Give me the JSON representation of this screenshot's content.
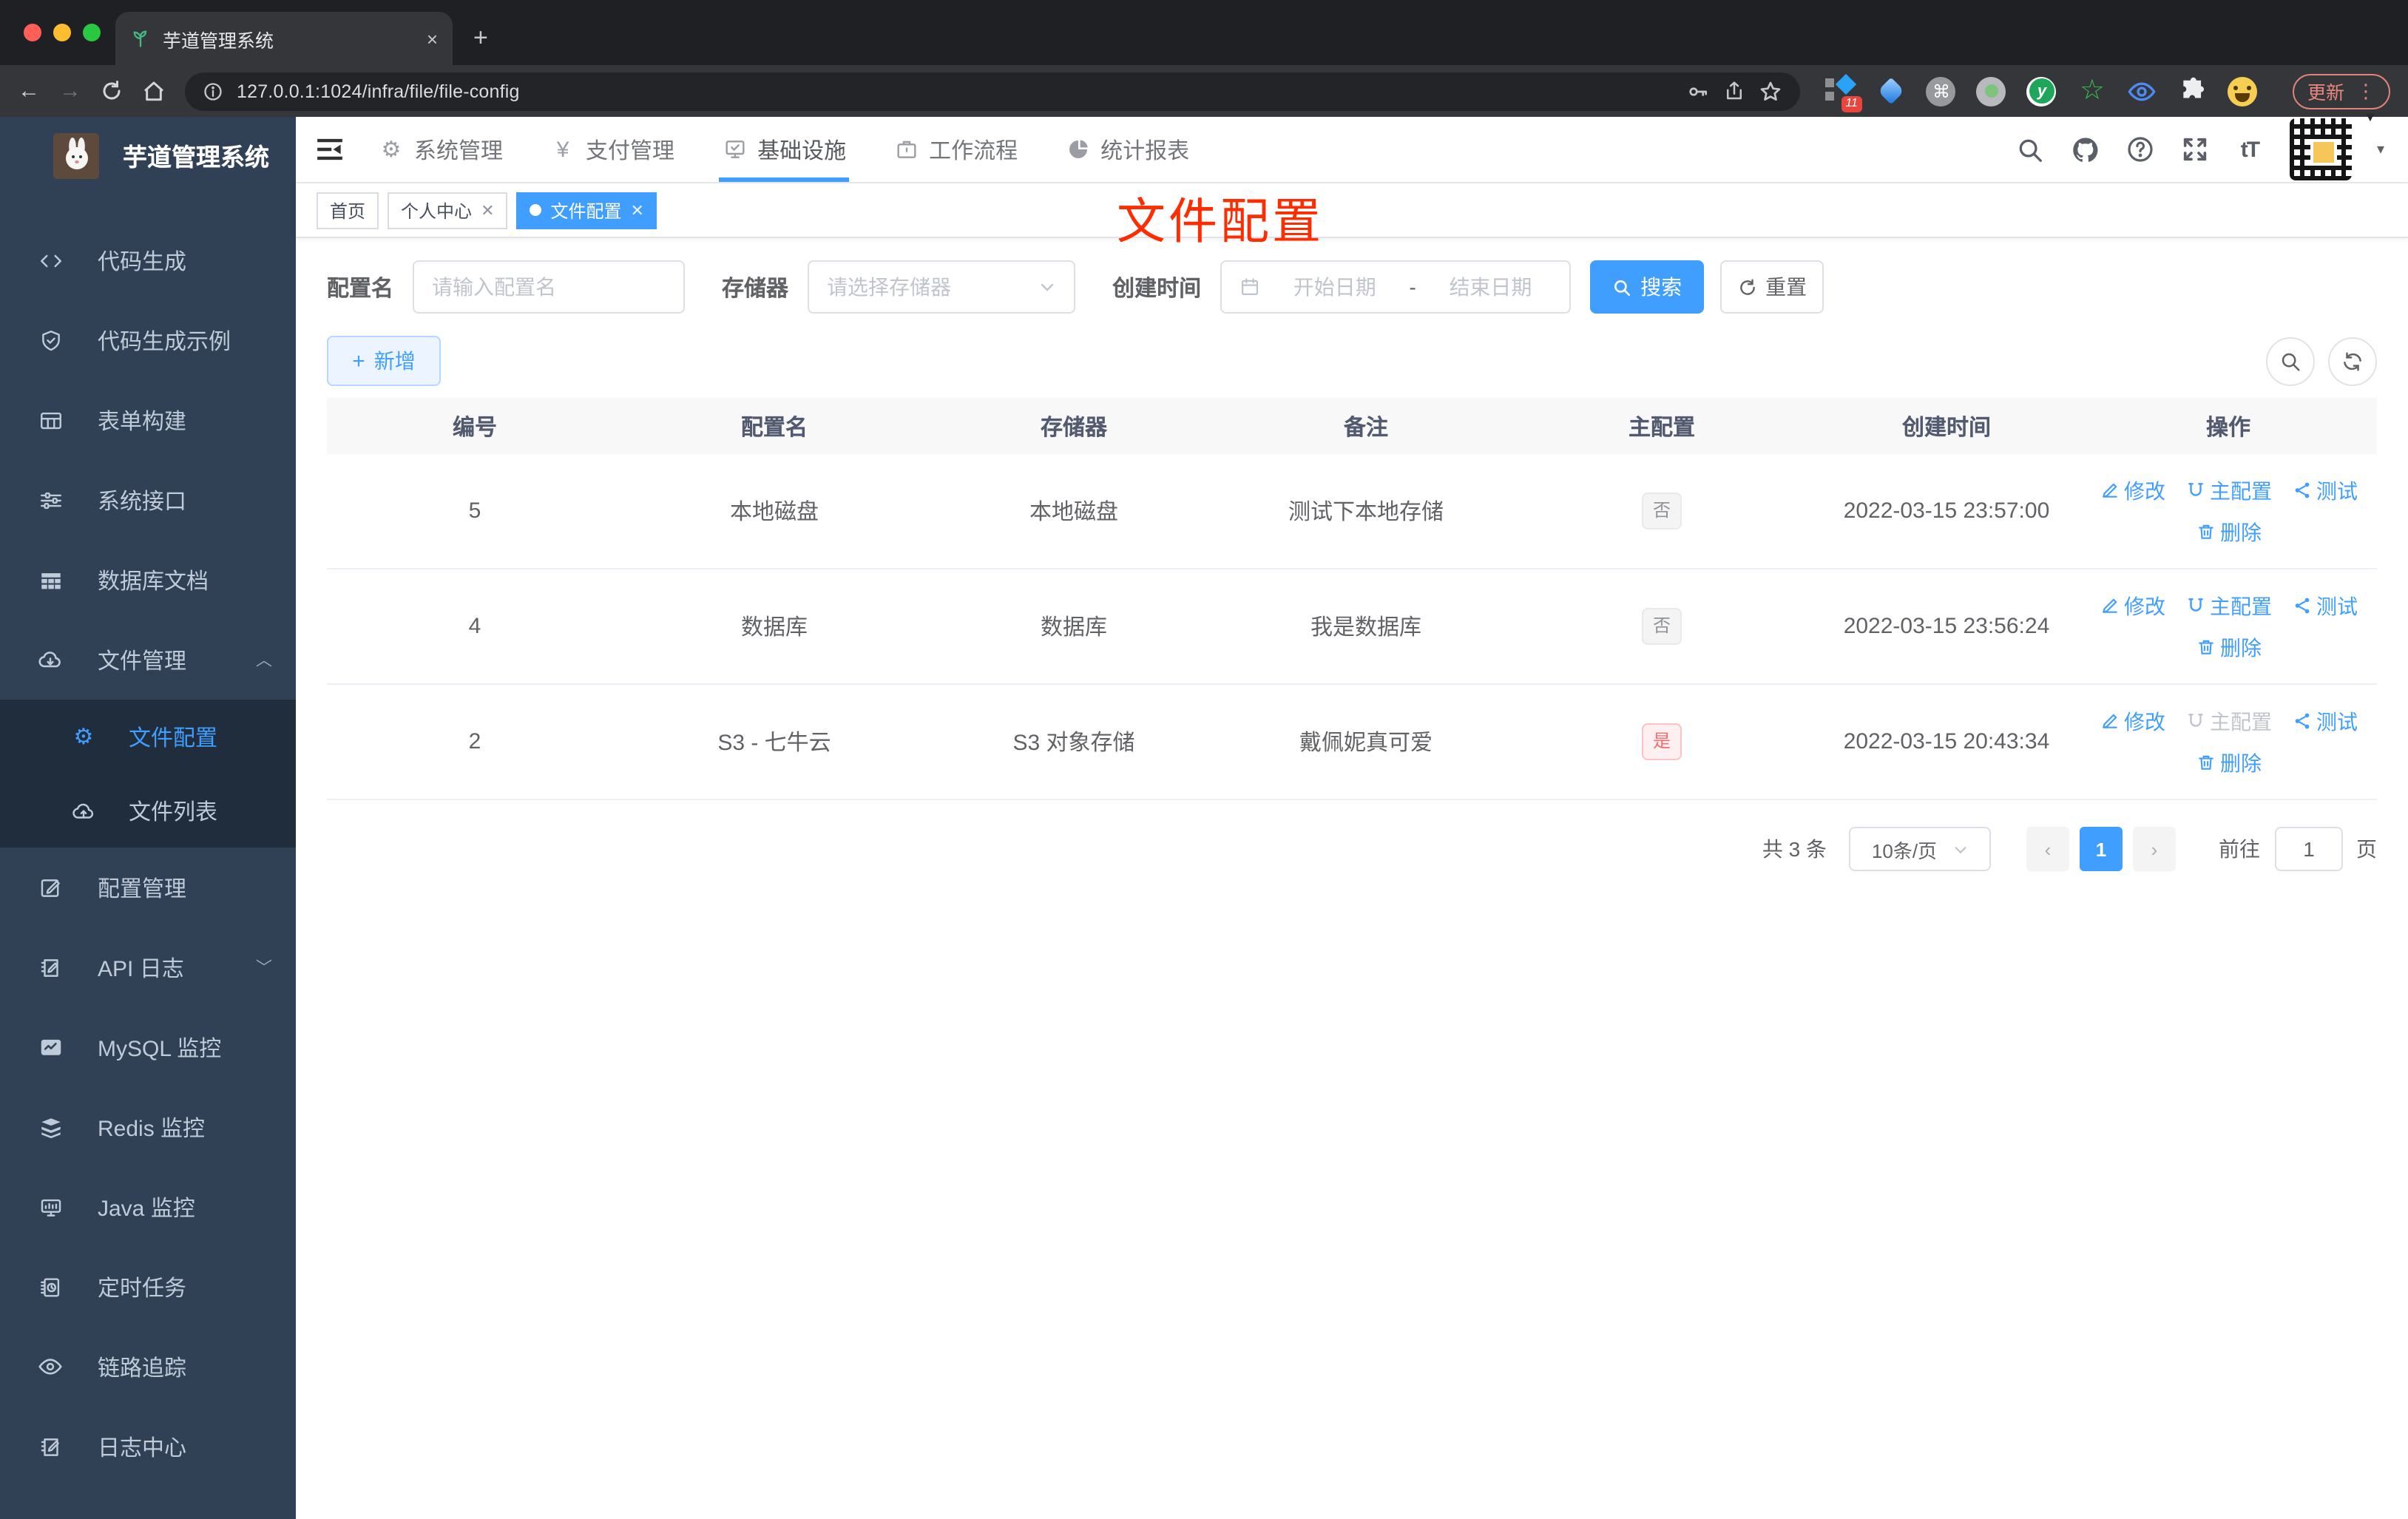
{
  "browser": {
    "tab_title": "芋道管理系统",
    "url": "127.0.0.1:1024/infra/file/file-config",
    "update_label": "更新",
    "extension_badge": "11",
    "new_tab_label": "+",
    "close_tab_label": "×"
  },
  "sidebar": {
    "logo_title": "芋道管理系统",
    "items": [
      {
        "label": "代码生成"
      },
      {
        "label": "代码生成示例"
      },
      {
        "label": "表单构建"
      },
      {
        "label": "系统接口"
      },
      {
        "label": "数据库文档"
      },
      {
        "label": "文件管理"
      },
      {
        "label": "配置管理"
      },
      {
        "label": "API 日志"
      },
      {
        "label": "MySQL 监控"
      },
      {
        "label": "Redis 监控"
      },
      {
        "label": "Java 监控"
      },
      {
        "label": "定时任务"
      },
      {
        "label": "链路追踪"
      },
      {
        "label": "日志中心"
      }
    ],
    "submenu": [
      {
        "label": "文件配置"
      },
      {
        "label": "文件列表"
      }
    ]
  },
  "header": {
    "nav": [
      {
        "label": "系统管理"
      },
      {
        "label": "支付管理"
      },
      {
        "label": "基础设施"
      },
      {
        "label": "工作流程"
      },
      {
        "label": "统计报表"
      }
    ],
    "font_size_icon": "tT"
  },
  "tags": [
    {
      "label": "首页"
    },
    {
      "label": "个人中心"
    },
    {
      "label": "文件配置"
    }
  ],
  "annotation": {
    "text": "文件配置",
    "color": "#fe2c00"
  },
  "filters": {
    "name_label": "配置名",
    "name_placeholder": "请输入配置名",
    "storage_label": "存储器",
    "storage_placeholder": "请选择存储器",
    "date_label": "创建时间",
    "date_start_placeholder": "开始日期",
    "date_separator": "-",
    "date_end_placeholder": "结束日期",
    "search_label": "搜索",
    "reset_label": "重置"
  },
  "toolbar": {
    "add_label": "新增"
  },
  "table": {
    "columns": [
      "编号",
      "配置名",
      "存储器",
      "备注",
      "主配置",
      "创建时间",
      "操作"
    ],
    "action_labels": {
      "edit": "修改",
      "master": "主配置",
      "test": "测试",
      "delete": "删除"
    },
    "rows": [
      {
        "id": "5",
        "name": "本地磁盘",
        "storage": "本地磁盘",
        "remark": "测试下本地存储",
        "master": "否",
        "created": "2022-03-15 23:57:00"
      },
      {
        "id": "4",
        "name": "数据库",
        "storage": "数据库",
        "remark": "我是数据库",
        "master": "否",
        "created": "2022-03-15 23:56:24"
      },
      {
        "id": "2",
        "name": "S3 - 七牛云",
        "storage": "S3 对象存储",
        "remark": "戴佩妮真可爱",
        "master": "是",
        "created": "2022-03-15 20:43:34"
      }
    ]
  },
  "pagination": {
    "total": "共 3 条",
    "page_size": "10条/页",
    "current": "1",
    "goto_label": "前往",
    "goto_value": "1",
    "page_unit": "页"
  },
  "colors": {
    "primary": "#409eff",
    "sidebar_bg": "#304156",
    "submenu_bg": "#1f2d3d",
    "annotation": "#fe2c00"
  }
}
